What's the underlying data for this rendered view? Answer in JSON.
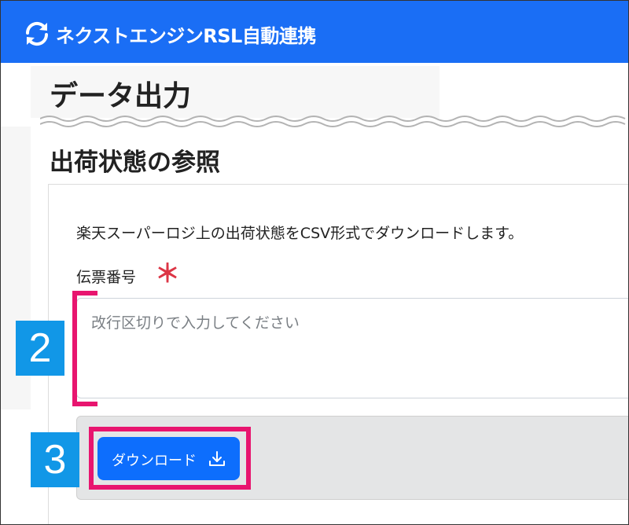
{
  "header": {
    "app_title": "ネクストエンジンRSL自動連携",
    "logo_icon": "sync-icon",
    "background_color": "#1a6ef5"
  },
  "page": {
    "title": "データ出力",
    "section_title": "出荷状態の参照"
  },
  "form": {
    "description": "楽天スーパーロジ上の出荷状態をCSV形式でダウンロードします。",
    "slip_number": {
      "label": "伝票番号",
      "required_mark": "＊",
      "placeholder": "改行区切りで入力してください",
      "value": ""
    },
    "download_button": {
      "label": "ダウンロード",
      "icon": "download-icon",
      "color": "#0d6efd"
    }
  },
  "annotations": {
    "step_a": "2",
    "step_b": "3",
    "highlight_color": "#e8156f",
    "badge_color": "#1197e7"
  }
}
